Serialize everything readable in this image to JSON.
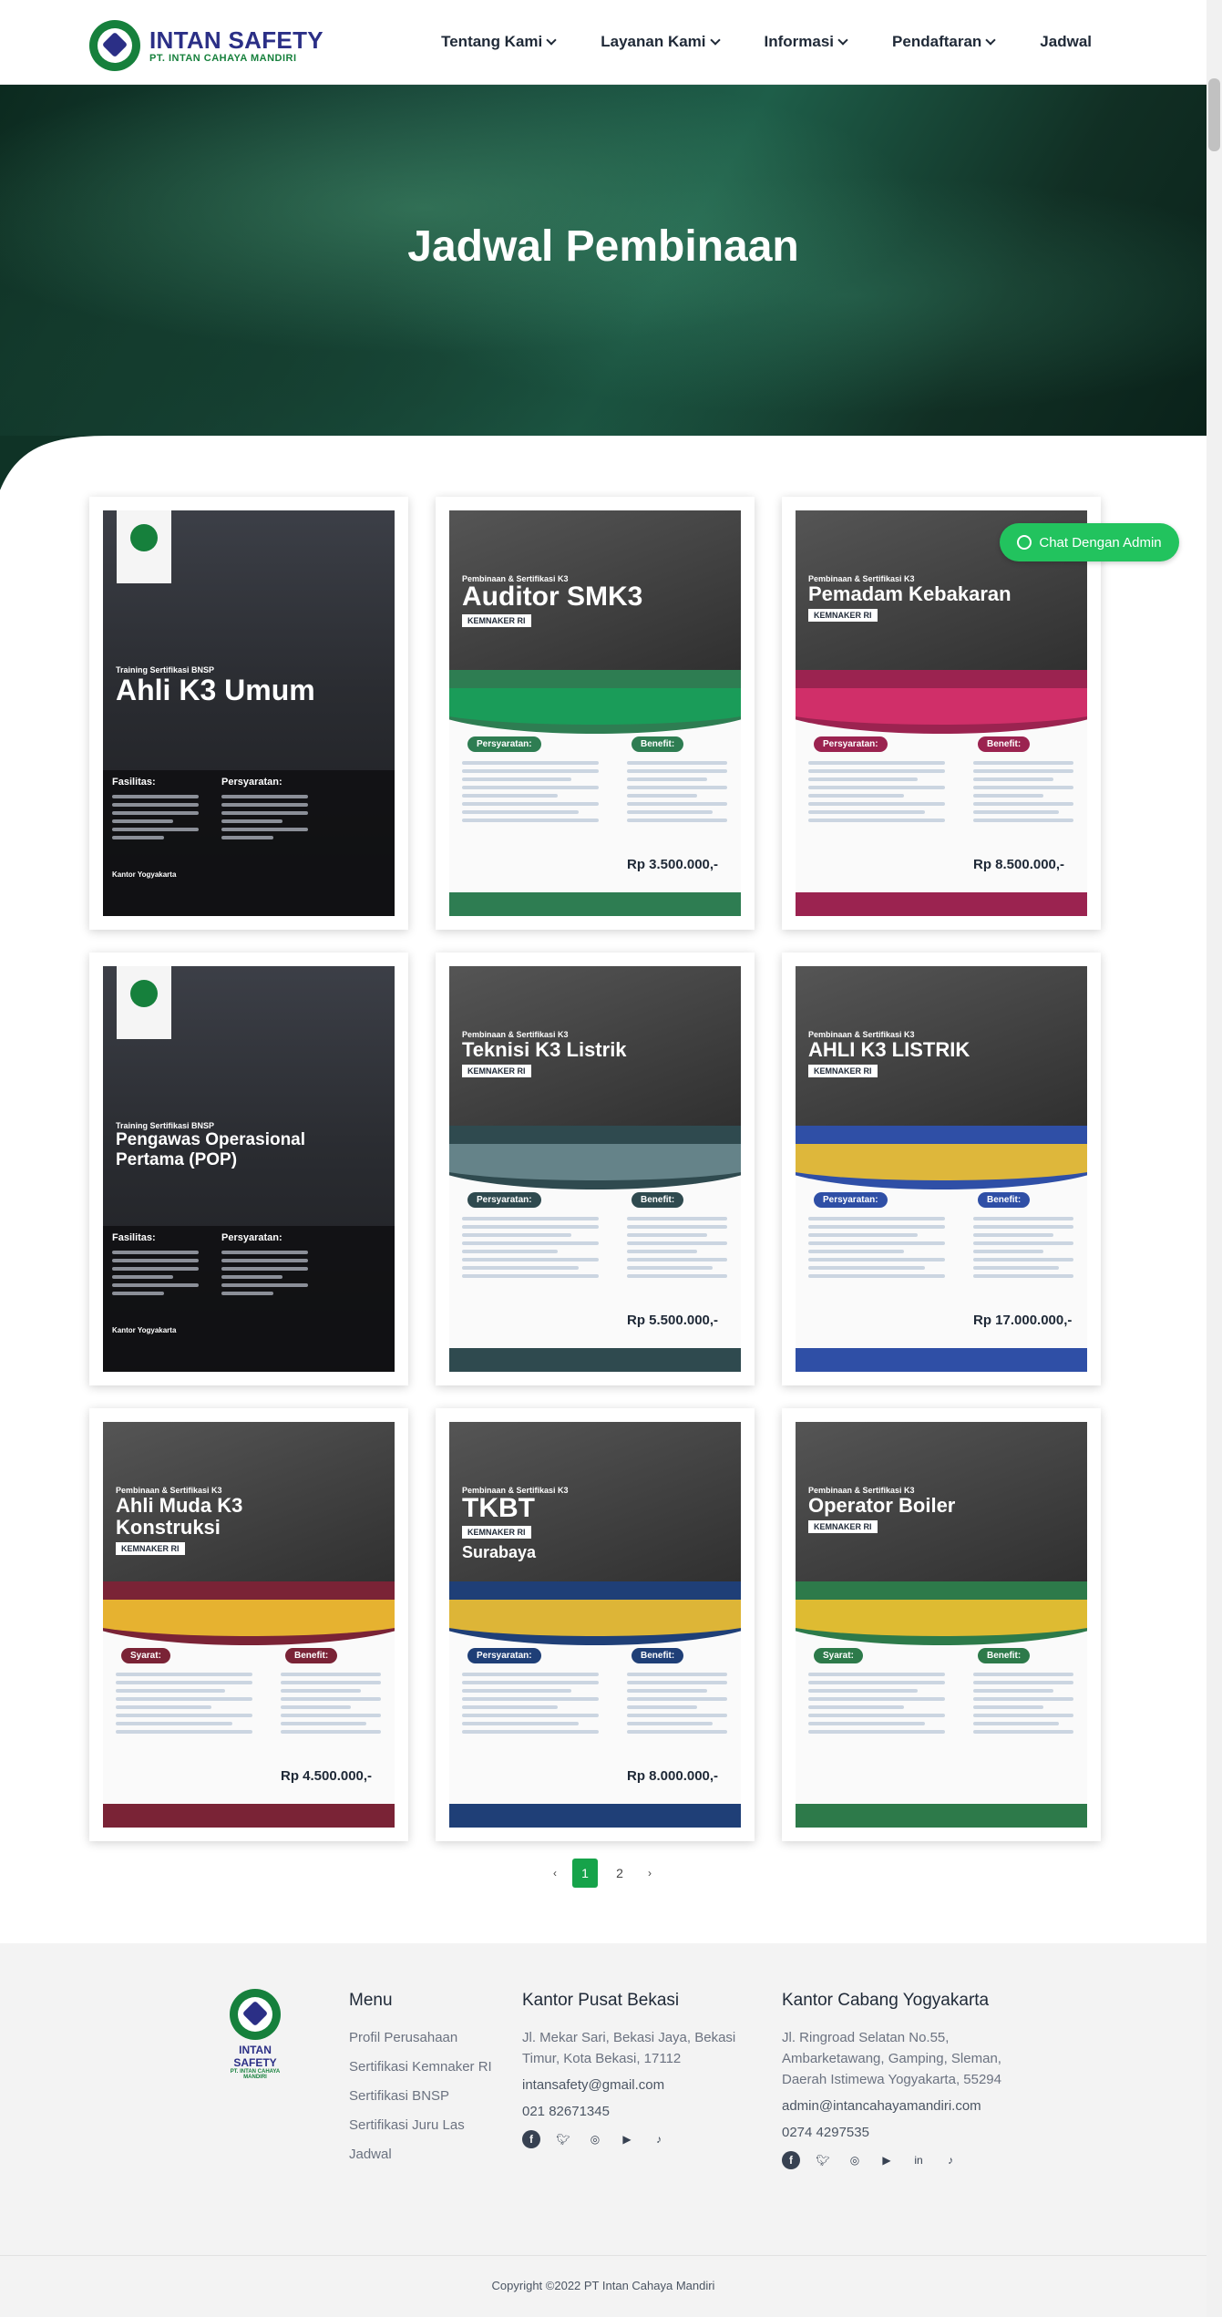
{
  "header": {
    "brand": "INTAN SAFETY",
    "brand_sub": "PT. INTAN CAHAYA MANDIRI",
    "nav": [
      "Tentang Kami",
      "Layanan Kami",
      "Informasi",
      "Pendaftaran",
      "Jadwal"
    ]
  },
  "hero": {
    "title": "Jadwal Pembinaan"
  },
  "chat": {
    "label": "Chat Dengan Admin"
  },
  "posters": [
    {
      "kind": "dark",
      "pre": "Training Sertifikasi BNSP",
      "title": "Ahli K3 Umum",
      "tag": "",
      "left_box": "Fasilitas:",
      "right_box": "Persyaratan:",
      "price": "",
      "office": "Kantor Yogyakarta"
    },
    {
      "kind": "green",
      "pre": "Pembinaan & Sertifikasi K3",
      "title": "Auditor SMK3",
      "tag": "KEMNAKER RI",
      "left_box": "Persyaratan:",
      "right_box": "Benefit:",
      "price": "Rp 3.500.000,-",
      "accent": "#1f8f4e"
    },
    {
      "kind": "pink",
      "pre": "Pembinaan & Sertifikasi K3",
      "title": "Pemadam Kebakaran",
      "tag": "KEMNAKER RI",
      "left_box": "Persyaratan:",
      "right_box": "Benefit:",
      "price": "Rp 8.500.000,-",
      "accent": "#b3235a"
    },
    {
      "kind": "dark",
      "pre": "Training Sertifikasi BNSP",
      "title": "Pengawas Operasional Pertama (POP)",
      "tag": "",
      "left_box": "Fasilitas:",
      "right_box": "Persyaratan:",
      "price": "",
      "office": "Kantor Yogyakarta"
    },
    {
      "kind": "slate",
      "pre": "Pembinaan & Sertifikasi K3",
      "title": "Teknisi K3 Listrik",
      "tag": "KEMNAKER RI",
      "left_box": "Persyaratan:",
      "right_box": "Benefit:",
      "price": "Rp 5.500.000,-",
      "accent": "#3f5e64"
    },
    {
      "kind": "blue",
      "pre": "Pembinaan & Sertifikasi K3",
      "title": "AHLI K3 LISTRIK",
      "tag": "KEMNAKER RI",
      "left_box": "Persyaratan:",
      "right_box": "Benefit:",
      "price": "Rp 17.000.000,-",
      "accent": "#3557b8"
    },
    {
      "kind": "maroon",
      "pre": "Pembinaan & Sertifikasi K3",
      "title": "Ahli Muda K3 Konstruksi",
      "tag": "KEMNAKER RI",
      "left_box": "Syarat:",
      "right_box": "Benefit:",
      "price": "Rp 4.500.000,-",
      "accent": "#7a2336"
    },
    {
      "kind": "navy",
      "pre": "Pembinaan & Sertifikasi K3",
      "title": "TKBT",
      "tag": "KEMNAKER RI",
      "left_box": "Persyaratan:",
      "right_box": "Benefit:",
      "price": "Rp 8.000.000,-",
      "accent": "#1f3f77",
      "city": "Surabaya"
    },
    {
      "kind": "green2",
      "pre": "Pembinaan & Sertifikasi K3",
      "title": "Operator Boiler",
      "tag": "KEMNAKER RI",
      "left_box": "Syarat:",
      "right_box": "Benefit:",
      "price": "",
      "accent": "#2d7a4a"
    }
  ],
  "pagination": {
    "prev": "‹",
    "pages": [
      "1",
      "2"
    ],
    "next": "›",
    "active": "1"
  },
  "footer": {
    "brand": "INTAN SAFETY",
    "brand_sub": "PT. INTAN CAHAYA MANDIRI",
    "menu": {
      "title": "Menu",
      "items": [
        "Profil Perusahaan",
        "Sertifikasi Kemnaker RI",
        "Sertifikasi BNSP",
        "Sertifikasi Juru Las",
        "Jadwal"
      ]
    },
    "bekasi": {
      "title": "Kantor Pusat Bekasi",
      "address": "Jl. Mekar Sari, Bekasi Jaya, Bekasi Timur, Kota Bekasi, 17112",
      "email": "intansafety@gmail.com",
      "phone": "021 82671345"
    },
    "yogya": {
      "title": "Kantor Cabang Yogyakarta",
      "address": "Jl. Ringroad Selatan No.55, Ambarketawang, Gamping, Sleman, Daerah Istimewa Yogyakarta, 55294",
      "email": "admin@intancahayamandiri.com",
      "phone": "0274 4297535"
    },
    "copyright": "Copyright ©2022 PT Intan Cahaya Mandiri"
  }
}
